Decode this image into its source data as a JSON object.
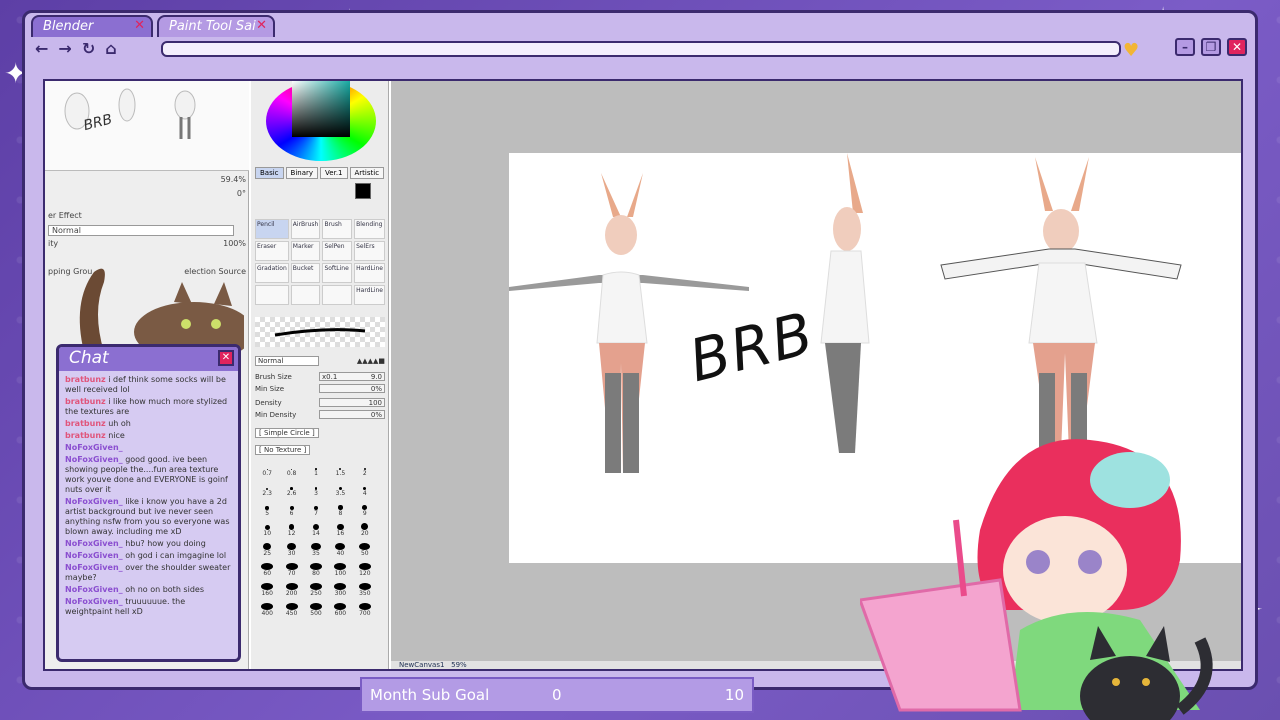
{
  "tabs": [
    {
      "label": "Blender"
    },
    {
      "label": "Paint Tool Sai"
    }
  ],
  "sai": {
    "zoom": "59.4%",
    "angle": "0°",
    "layer_effect_label": "er Effect",
    "blend_mode": "Normal",
    "opacity_label": "ity",
    "opacity": "100%",
    "clipping_label": "pping Grou",
    "selection_label": "election Source",
    "mode_tabs": [
      "Basic",
      "Binary",
      "Ver.1",
      "Artistic"
    ],
    "tools": [
      {
        "label": "Pencil",
        "active": true
      },
      {
        "label": "AirBrush"
      },
      {
        "label": "Brush"
      },
      {
        "label": "Blending"
      },
      {
        "label": "Eraser"
      },
      {
        "label": "Marker"
      },
      {
        "label": "SelPen"
      },
      {
        "label": "SelErs"
      },
      {
        "label": "Gradation"
      },
      {
        "label": "Bucket"
      },
      {
        "label": "SoftLine"
      },
      {
        "label": "HardLine"
      },
      {
        "label": ""
      },
      {
        "label": ""
      },
      {
        "label": ""
      },
      {
        "label": "HardLine"
      }
    ],
    "brush_mode": "Normal",
    "brush_size_label": "Brush Size",
    "brush_size_mult": "x0.1",
    "brush_size": "9.0",
    "min_size_label": "Min Size",
    "min_size": "0%",
    "density_label": "Density",
    "density": "100",
    "min_density_label": "Min Density",
    "min_density": "0%",
    "shape": "[ Simple Circle ]",
    "texture": "[ No Texture ]",
    "brush_sizes": [
      "0.7",
      "0.8",
      "1",
      "1.5",
      "2",
      "2.3",
      "2.6",
      "3",
      "3.5",
      "4",
      "5",
      "6",
      "7",
      "8",
      "9",
      "10",
      "12",
      "14",
      "16",
      "20",
      "25",
      "30",
      "35",
      "40",
      "50",
      "60",
      "70",
      "80",
      "100",
      "120",
      "160",
      "200",
      "250",
      "300",
      "350",
      "400",
      "450",
      "500",
      "600",
      "700"
    ],
    "canvas_name": "NewCanvas1",
    "canvas_zoom": "59%",
    "canvas_text": "BRB"
  },
  "chat": {
    "title": "Chat",
    "messages": [
      {
        "user": "bratbunz",
        "text": "i def think some socks will be well received lol"
      },
      {
        "user": "bratbunz",
        "text": "i like how much more stylized the textures are"
      },
      {
        "user": "bratbunz",
        "text": "uh oh"
      },
      {
        "user": "bratbunz",
        "text": "nice"
      },
      {
        "user": "NoFoxGiven_",
        "text": ""
      },
      {
        "user": "NoFoxGiven_",
        "text": "good good. ive been showing people the....fun area texture work youve done and EVERYONE is goinf nuts over it"
      },
      {
        "user": "NoFoxGiven_",
        "text": "like i know you have a 2d artist background but ive never seen anything nsfw from you so everyone was blown away. including me xD"
      },
      {
        "user": "NoFoxGiven_",
        "text": "hbu? how you doing"
      },
      {
        "user": "NoFoxGiven_",
        "text": "oh god i can imgagine lol"
      },
      {
        "user": "NoFoxGiven_",
        "text": "over the shoulder sweater maybe?"
      },
      {
        "user": "NoFoxGiven_",
        "text": "oh no on both sides"
      },
      {
        "user": "NoFoxGiven_",
        "text": "truuuuuue. the weightpaint hell xD"
      }
    ]
  },
  "goal": {
    "label": "Month Sub Goal",
    "current": "0",
    "target": "10",
    "progress": 0
  },
  "colors": {
    "frame": "#3b2a6e",
    "accent": "#8b6fd1",
    "bg": "#6a4fb0",
    "close": "#e0245e",
    "heart": "#f2b534"
  }
}
